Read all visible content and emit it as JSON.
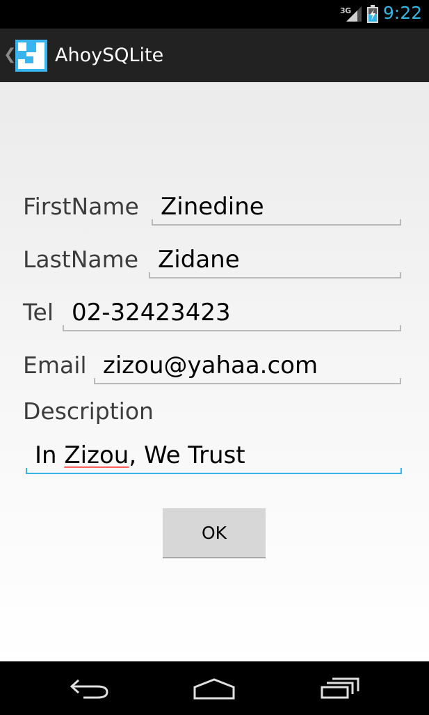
{
  "status_bar": {
    "network": "3G",
    "time": "9:22",
    "accent_color": "#33b5e5"
  },
  "action_bar": {
    "title": "AhoySQLite",
    "icon": "app-logo-icon"
  },
  "form": {
    "first_name_label": "FirstName",
    "first_name_value": "Zinedine",
    "last_name_label": "LastName",
    "last_name_value": "Zidane",
    "tel_label": "Tel",
    "tel_value": "02-32423423",
    "email_label": "Email",
    "email_value": "zizou@yahaa.com",
    "description_label": "Description",
    "description_before": "In ",
    "description_flagged": "Zizou",
    "description_after": ", We Trust",
    "ok_label": "OK"
  },
  "nav_bar": {
    "back_icon": "back-icon",
    "home_icon": "home-icon",
    "recents_icon": "recent-apps-icon"
  }
}
